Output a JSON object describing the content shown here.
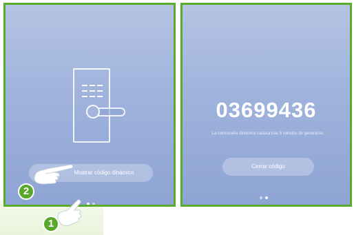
{
  "screens": {
    "left": {
      "button_label": "Mostrar código dinámico",
      "dots": 2,
      "active_dot": 0
    },
    "right": {
      "code": "03699436",
      "description": "La contraseña dinámica caduca tras 5 minutos de generarse.",
      "button_label": "Cerrar código",
      "dots": 2,
      "active_dot": 1
    }
  },
  "callouts": {
    "step_1": "1",
    "step_2": "2"
  },
  "colors": {
    "frame": "#5bab2b",
    "badge": "#59a82a",
    "panel_top": "#b5c4e3",
    "panel_bottom": "#8ea4d4"
  },
  "icons": [
    "door-lock-icon",
    "pointing-hand-icon"
  ]
}
